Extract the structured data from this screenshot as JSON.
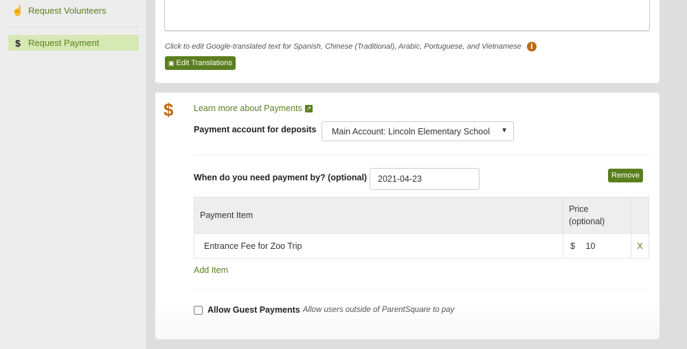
{
  "sidebar": {
    "items": [
      {
        "label": "Request Volunteers",
        "icon": "hand-icon",
        "active": false
      },
      {
        "label": "Request Payment",
        "icon": "dollar-icon",
        "active": true
      }
    ]
  },
  "translation": {
    "note": "Click to edit Google-translated text for Spanish, Chinese (Traditional), Arabic, Portuguese, and Vietnamese",
    "info_icon": "i",
    "edit_button": "Edit Translations"
  },
  "payment": {
    "section_icon": "$",
    "learn_more_link": "Learn more about Payments",
    "account_label": "Payment account for deposits",
    "account_selected": "Main Account: Lincoln Elementary School",
    "due_label": "When do you need payment by? (optional)",
    "due_value": "2021-04-23",
    "remove_button": "Remove",
    "table": {
      "headers": [
        "Payment Item",
        "Price (optional)",
        ""
      ],
      "price_header_line1": "Price",
      "price_header_line2": "(optional)",
      "rows": [
        {
          "item": "Entrance Fee for Zoo Trip",
          "currency": "$",
          "price": "10",
          "delete": "X"
        }
      ]
    },
    "add_item_link": "Add Item",
    "guest_label": "Allow Guest Payments",
    "guest_hint": "Allow users outside of ParentSquare to pay",
    "guest_checked": false
  },
  "colors": {
    "brand_green": "#5a7f1f",
    "accent_orange": "#c0690c",
    "active_bg": "#d6e8b4"
  }
}
